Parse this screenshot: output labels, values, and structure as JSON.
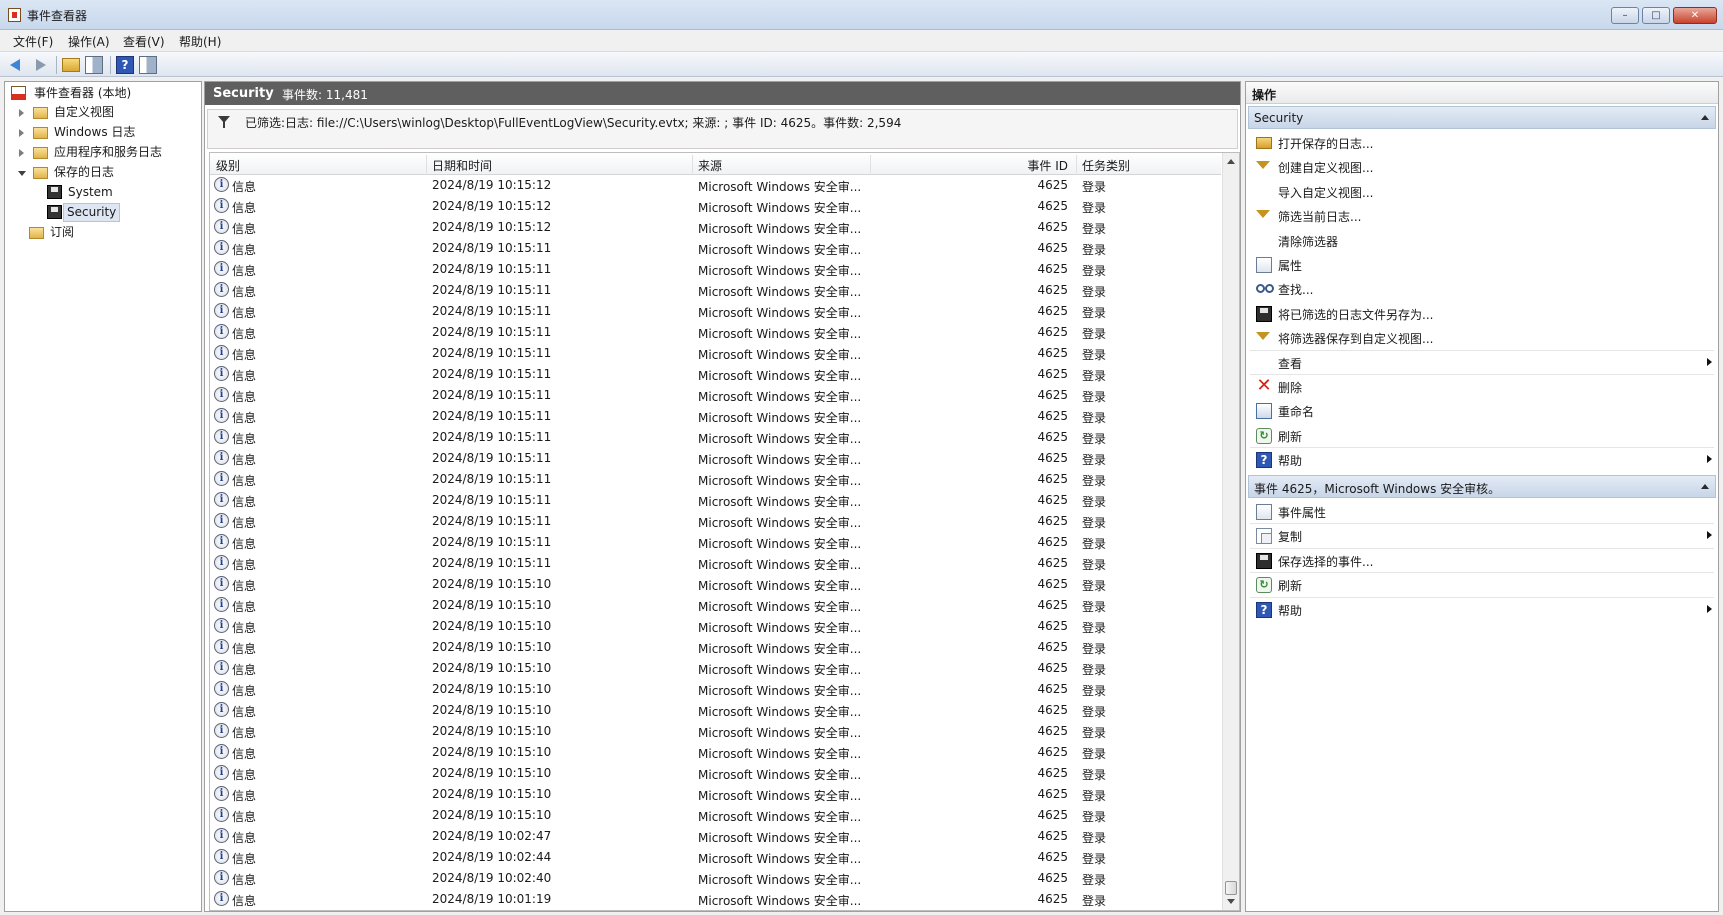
{
  "window": {
    "title": "事件查看器",
    "minimize": "–",
    "maximize": "□",
    "close": "✕"
  },
  "menu": [
    "文件(F)",
    "操作(A)",
    "查看(V)",
    "帮助(H)"
  ],
  "toolbar": {
    "help_glyph": "?"
  },
  "tree": {
    "root": "事件查看器 (本地)",
    "items": [
      "自定义视图",
      "Windows 日志",
      "应用程序和服务日志",
      "保存的日志"
    ],
    "saved_logs": [
      "System",
      "Security"
    ],
    "subscriptions": "订阅",
    "selected": "Security"
  },
  "center": {
    "title": "Security",
    "count_label": "事件数: 11,481",
    "filter_text": "已筛选:日志: file://C:\\Users\\winlog\\Desktop\\FullEventLogView\\Security.evtx; 来源: ; 事件 ID: 4625。事件数: 2,594",
    "columns": {
      "level": "级别",
      "datetime": "日期和时间",
      "source": "来源",
      "event_id": "事件 ID",
      "task": "任务类别"
    },
    "rows": [
      {
        "level": "信息",
        "datetime": "2024/8/19 10:15:12",
        "source": "Microsoft Windows 安全审...",
        "event_id": "4625",
        "task": "登录"
      },
      {
        "level": "信息",
        "datetime": "2024/8/19 10:15:12",
        "source": "Microsoft Windows 安全审...",
        "event_id": "4625",
        "task": "登录"
      },
      {
        "level": "信息",
        "datetime": "2024/8/19 10:15:12",
        "source": "Microsoft Windows 安全审...",
        "event_id": "4625",
        "task": "登录"
      },
      {
        "level": "信息",
        "datetime": "2024/8/19 10:15:11",
        "source": "Microsoft Windows 安全审...",
        "event_id": "4625",
        "task": "登录"
      },
      {
        "level": "信息",
        "datetime": "2024/8/19 10:15:11",
        "source": "Microsoft Windows 安全审...",
        "event_id": "4625",
        "task": "登录"
      },
      {
        "level": "信息",
        "datetime": "2024/8/19 10:15:11",
        "source": "Microsoft Windows 安全审...",
        "event_id": "4625",
        "task": "登录"
      },
      {
        "level": "信息",
        "datetime": "2024/8/19 10:15:11",
        "source": "Microsoft Windows 安全审...",
        "event_id": "4625",
        "task": "登录"
      },
      {
        "level": "信息",
        "datetime": "2024/8/19 10:15:11",
        "source": "Microsoft Windows 安全审...",
        "event_id": "4625",
        "task": "登录"
      },
      {
        "level": "信息",
        "datetime": "2024/8/19 10:15:11",
        "source": "Microsoft Windows 安全审...",
        "event_id": "4625",
        "task": "登录"
      },
      {
        "level": "信息",
        "datetime": "2024/8/19 10:15:11",
        "source": "Microsoft Windows 安全审...",
        "event_id": "4625",
        "task": "登录"
      },
      {
        "level": "信息",
        "datetime": "2024/8/19 10:15:11",
        "source": "Microsoft Windows 安全审...",
        "event_id": "4625",
        "task": "登录"
      },
      {
        "level": "信息",
        "datetime": "2024/8/19 10:15:11",
        "source": "Microsoft Windows 安全审...",
        "event_id": "4625",
        "task": "登录"
      },
      {
        "level": "信息",
        "datetime": "2024/8/19 10:15:11",
        "source": "Microsoft Windows 安全审...",
        "event_id": "4625",
        "task": "登录"
      },
      {
        "level": "信息",
        "datetime": "2024/8/19 10:15:11",
        "source": "Microsoft Windows 安全审...",
        "event_id": "4625",
        "task": "登录"
      },
      {
        "level": "信息",
        "datetime": "2024/8/19 10:15:11",
        "source": "Microsoft Windows 安全审...",
        "event_id": "4625",
        "task": "登录"
      },
      {
        "level": "信息",
        "datetime": "2024/8/19 10:15:11",
        "source": "Microsoft Windows 安全审...",
        "event_id": "4625",
        "task": "登录"
      },
      {
        "level": "信息",
        "datetime": "2024/8/19 10:15:11",
        "source": "Microsoft Windows 安全审...",
        "event_id": "4625",
        "task": "登录"
      },
      {
        "level": "信息",
        "datetime": "2024/8/19 10:15:11",
        "source": "Microsoft Windows 安全审...",
        "event_id": "4625",
        "task": "登录"
      },
      {
        "level": "信息",
        "datetime": "2024/8/19 10:15:11",
        "source": "Microsoft Windows 安全审...",
        "event_id": "4625",
        "task": "登录"
      },
      {
        "level": "信息",
        "datetime": "2024/8/19 10:15:10",
        "source": "Microsoft Windows 安全审...",
        "event_id": "4625",
        "task": "登录"
      },
      {
        "level": "信息",
        "datetime": "2024/8/19 10:15:10",
        "source": "Microsoft Windows 安全审...",
        "event_id": "4625",
        "task": "登录"
      },
      {
        "level": "信息",
        "datetime": "2024/8/19 10:15:10",
        "source": "Microsoft Windows 安全审...",
        "event_id": "4625",
        "task": "登录"
      },
      {
        "level": "信息",
        "datetime": "2024/8/19 10:15:10",
        "source": "Microsoft Windows 安全审...",
        "event_id": "4625",
        "task": "登录"
      },
      {
        "level": "信息",
        "datetime": "2024/8/19 10:15:10",
        "source": "Microsoft Windows 安全审...",
        "event_id": "4625",
        "task": "登录"
      },
      {
        "level": "信息",
        "datetime": "2024/8/19 10:15:10",
        "source": "Microsoft Windows 安全审...",
        "event_id": "4625",
        "task": "登录"
      },
      {
        "level": "信息",
        "datetime": "2024/8/19 10:15:10",
        "source": "Microsoft Windows 安全审...",
        "event_id": "4625",
        "task": "登录"
      },
      {
        "level": "信息",
        "datetime": "2024/8/19 10:15:10",
        "source": "Microsoft Windows 安全审...",
        "event_id": "4625",
        "task": "登录"
      },
      {
        "level": "信息",
        "datetime": "2024/8/19 10:15:10",
        "source": "Microsoft Windows 安全审...",
        "event_id": "4625",
        "task": "登录"
      },
      {
        "level": "信息",
        "datetime": "2024/8/19 10:15:10",
        "source": "Microsoft Windows 安全审...",
        "event_id": "4625",
        "task": "登录"
      },
      {
        "level": "信息",
        "datetime": "2024/8/19 10:15:10",
        "source": "Microsoft Windows 安全审...",
        "event_id": "4625",
        "task": "登录"
      },
      {
        "level": "信息",
        "datetime": "2024/8/19 10:15:10",
        "source": "Microsoft Windows 安全审...",
        "event_id": "4625",
        "task": "登录"
      },
      {
        "level": "信息",
        "datetime": "2024/8/19 10:02:47",
        "source": "Microsoft Windows 安全审...",
        "event_id": "4625",
        "task": "登录"
      },
      {
        "level": "信息",
        "datetime": "2024/8/19 10:02:44",
        "source": "Microsoft Windows 安全审...",
        "event_id": "4625",
        "task": "登录"
      },
      {
        "level": "信息",
        "datetime": "2024/8/19 10:02:40",
        "source": "Microsoft Windows 安全审...",
        "event_id": "4625",
        "task": "登录"
      },
      {
        "level": "信息",
        "datetime": "2024/8/19 10:01:19",
        "source": "Microsoft Windows 安全审...",
        "event_id": "4625",
        "task": "登录"
      }
    ]
  },
  "actions": {
    "title": "操作",
    "section1": {
      "title": "Security",
      "items": [
        {
          "label": "打开保存的日志...",
          "icon": "open-folder-icon"
        },
        {
          "label": "创建自定义视图...",
          "icon": "filter-icon"
        },
        {
          "label": "导入自定义视图...",
          "icon": "none"
        },
        {
          "label": "筛选当前日志...",
          "icon": "filter-icon"
        },
        {
          "label": "清除筛选器",
          "icon": "none"
        },
        {
          "label": "属性",
          "icon": "properties-icon"
        },
        {
          "label": "查找...",
          "icon": "find-icon"
        },
        {
          "label": "将已筛选的日志文件另存为...",
          "icon": "save-icon"
        },
        {
          "label": "将筛选器保存到自定义视图...",
          "icon": "filter-icon"
        },
        {
          "label": "查看",
          "icon": "none"
        },
        {
          "label": "删除",
          "icon": "delete-icon"
        },
        {
          "label": "重命名",
          "icon": "rename-icon"
        },
        {
          "label": "刷新",
          "icon": "refresh-icon"
        },
        {
          "label": "帮助",
          "icon": "help-icon"
        }
      ]
    },
    "section2": {
      "title": "事件 4625，Microsoft Windows 安全审核。",
      "items": [
        {
          "label": "事件属性",
          "icon": "properties-icon"
        },
        {
          "label": "复制",
          "icon": "copy-icon"
        },
        {
          "label": "保存选择的事件...",
          "icon": "save-icon"
        },
        {
          "label": "刷新",
          "icon": "refresh-icon"
        },
        {
          "label": "帮助",
          "icon": "help-icon"
        }
      ]
    }
  }
}
